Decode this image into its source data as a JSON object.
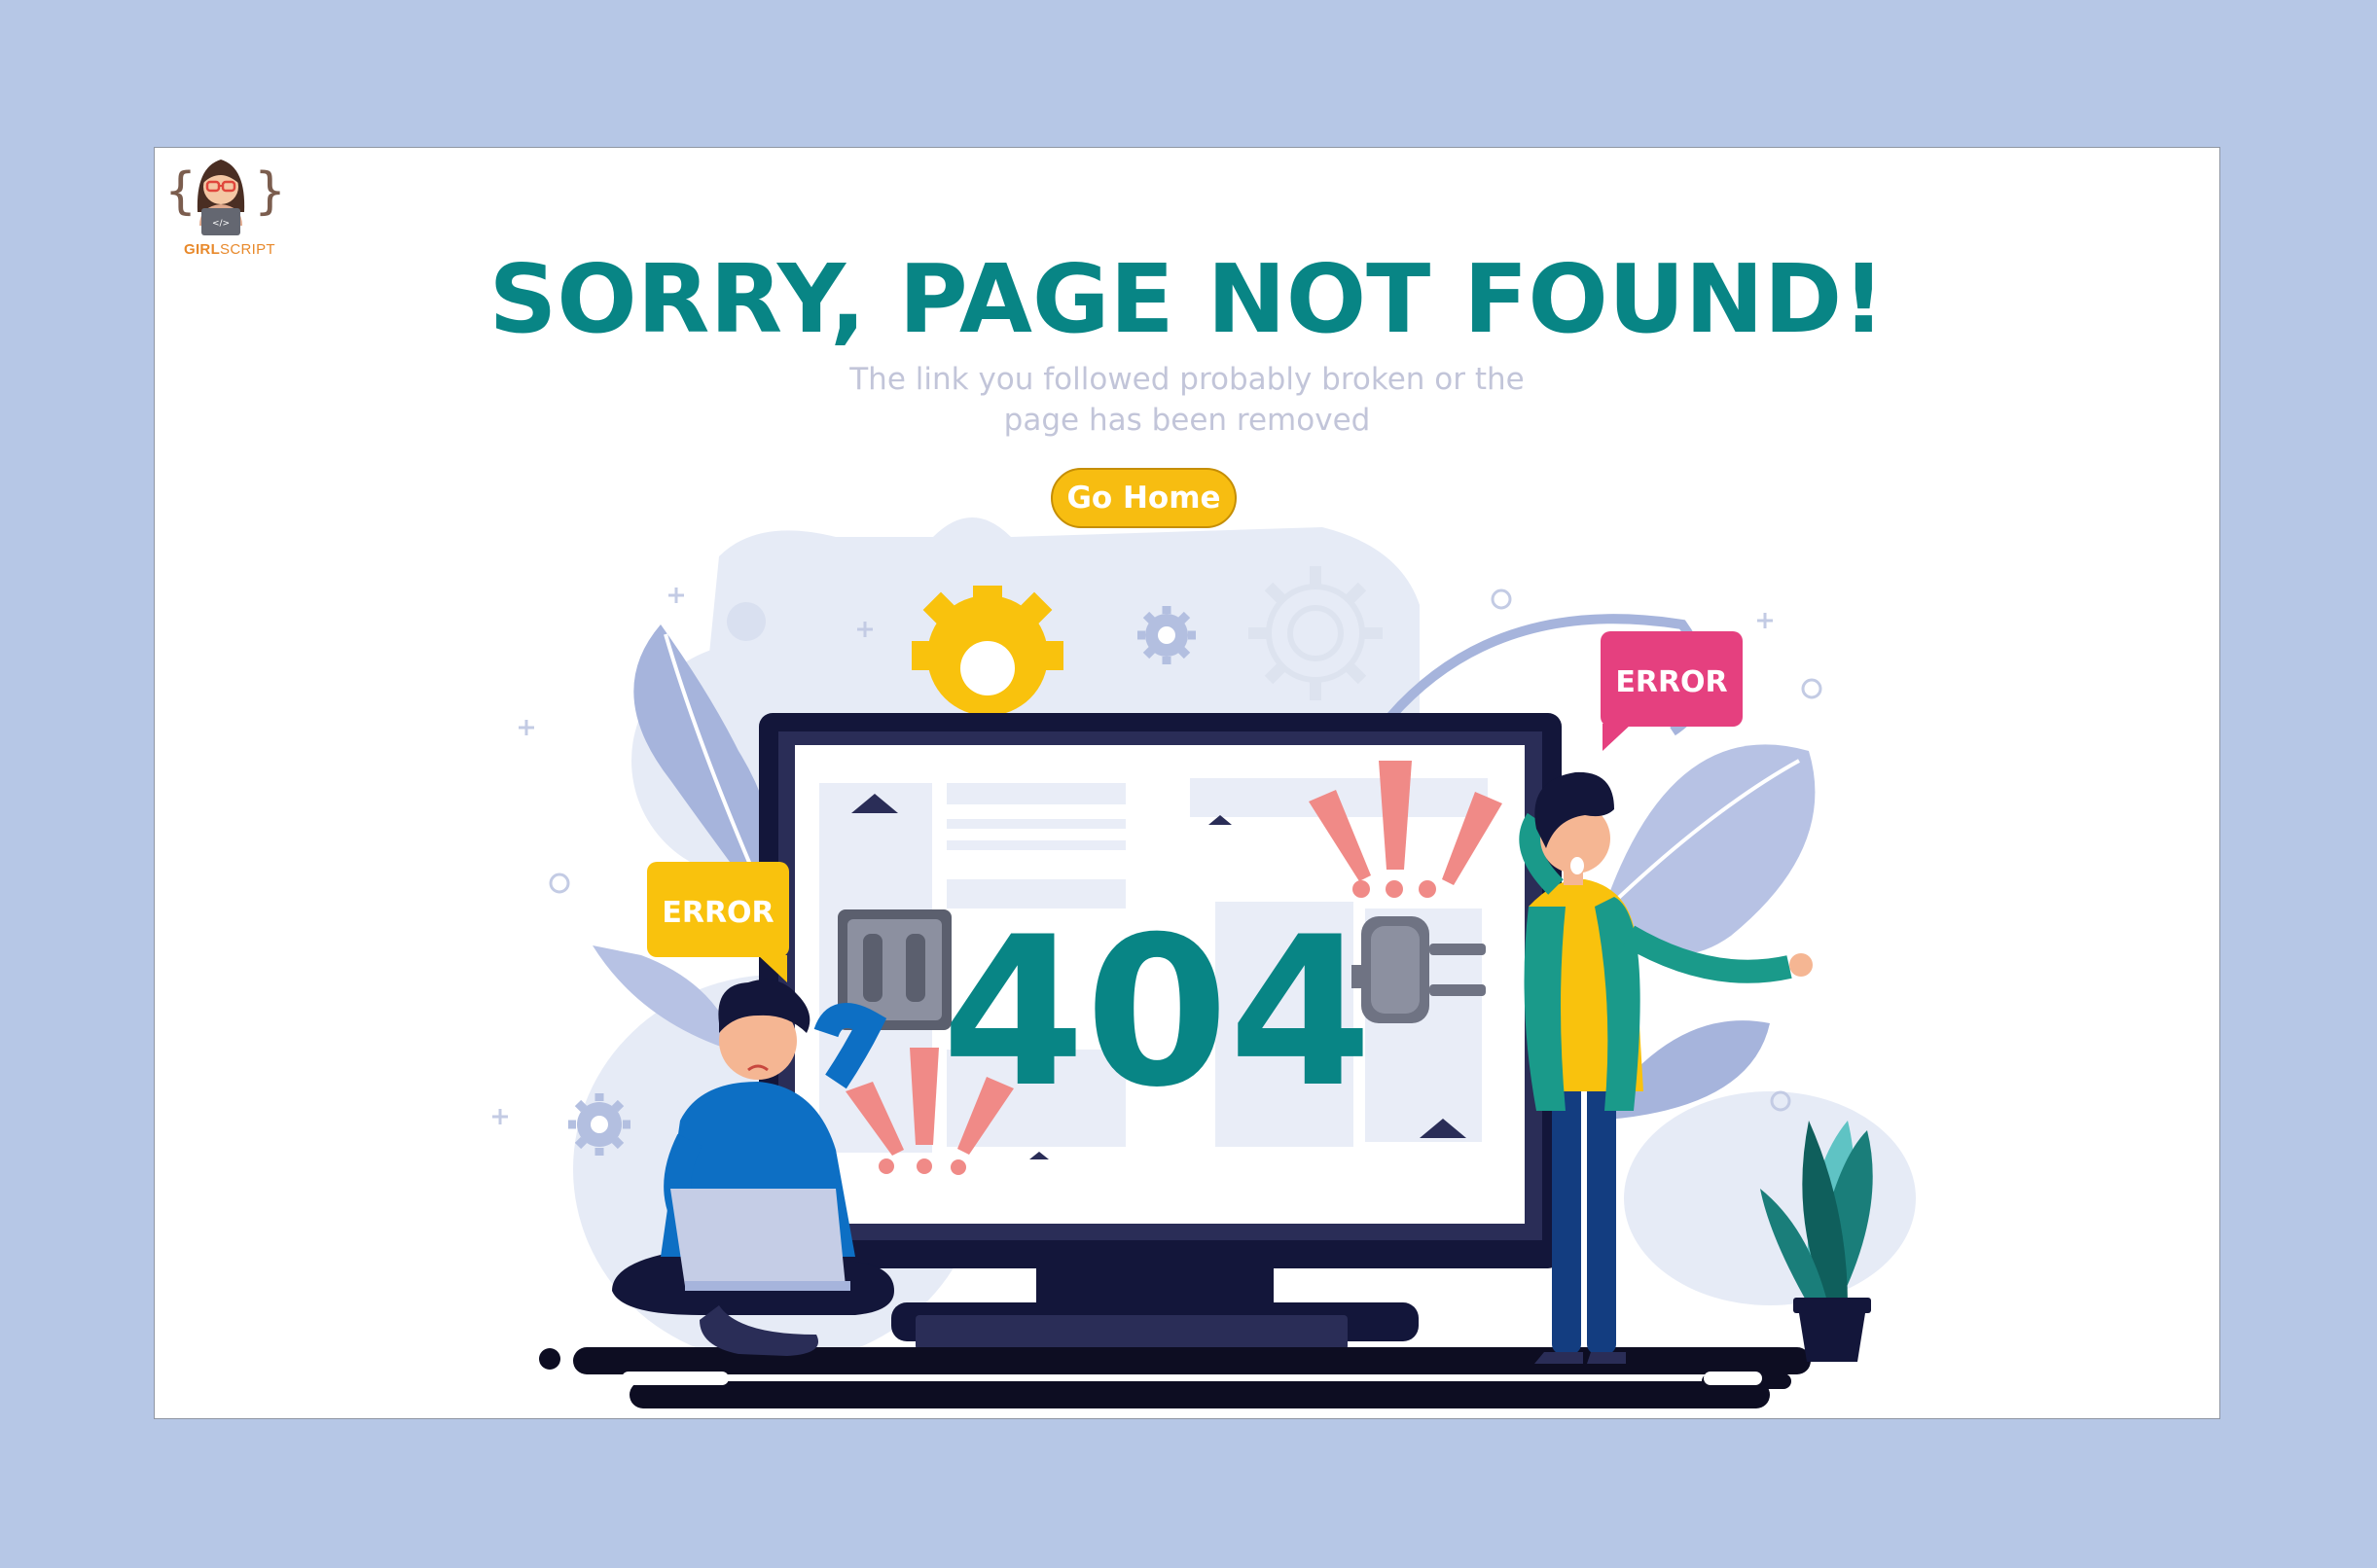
{
  "logo": {
    "text_a": "GIRL",
    "text_b": "SCRIPT",
    "code": "</>"
  },
  "title": "SORRY, PAGE NOT FOUND!",
  "subtitle_line1": "The link you followed probably broken or the",
  "subtitle_line2": "page has been removed",
  "go_home_label": "Go Home",
  "illustration": {
    "code": "404",
    "left_bubble": "ERROR",
    "right_bubble": "ERROR"
  },
  "colors": {
    "background": "#b6c7e6",
    "title": "#088585",
    "button": "#f7bd11",
    "error_yellow": "#f9c20d",
    "error_pink": "#e5407f"
  }
}
